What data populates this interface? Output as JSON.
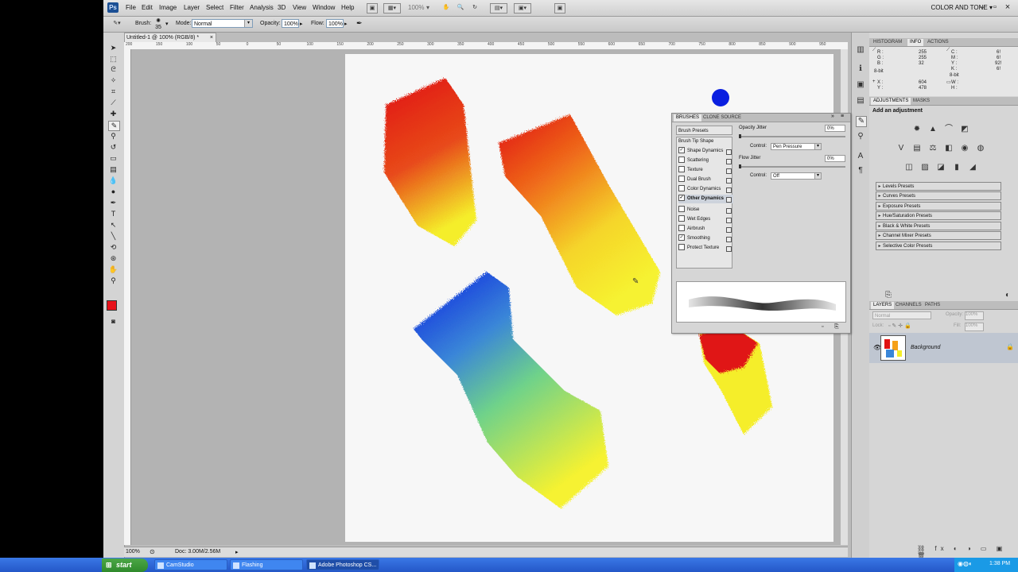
{
  "app": {
    "logo": "Ps",
    "menu": [
      "File",
      "Edit",
      "Image",
      "Layer",
      "Select",
      "Filter",
      "Analysis",
      "3D",
      "View",
      "Window",
      "Help"
    ],
    "zoom_label": "100%",
    "workspace": "COLOR AND TONE"
  },
  "options": {
    "brush_label": "Brush:",
    "brush_size": "35",
    "mode_label": "Mode:",
    "mode_value": "Normal",
    "opacity_label": "Opacity:",
    "opacity_value": "100%",
    "flow_label": "Flow:",
    "flow_value": "100%"
  },
  "document": {
    "tab_title": "Untitled-1 @ 100% (RGB/8) *",
    "zoom": "100%",
    "doc_info": "Doc: 3.00M/2.56M",
    "ruler_labels": [
      "200",
      "150",
      "100",
      "50",
      "0",
      "50",
      "100",
      "150",
      "200",
      "250",
      "300",
      "350",
      "400",
      "450",
      "500",
      "550",
      "600",
      "650",
      "700",
      "750",
      "800",
      "850",
      "900",
      "950"
    ]
  },
  "colors": {
    "foreground": "#e8121b",
    "background": "#ffffff",
    "red": "#e01212",
    "yellow": "#f5ee2a",
    "blue": "#0a1fe0"
  },
  "info_panel": {
    "tabs": [
      "HISTOGRAM",
      "INFO",
      "ACTIONS"
    ],
    "r_label": "R :",
    "r_value": "255",
    "g_label": "G :",
    "g_value": "255",
    "b_label": "B :",
    "b_value": "32",
    "bit1": "8-bit",
    "c_label": "C :",
    "c_value": "",
    "m_label": "M :",
    "m_value": "",
    "y_label": "Y :",
    "y_value": "",
    "k_label": "K :",
    "k_value": "",
    "cmyk_right": [
      "6!",
      "6!",
      "92!",
      "6!"
    ],
    "bit2": "8-bit",
    "x_label": "X :",
    "x_value": "604",
    "y2_label": "Y :",
    "y2_value": "478",
    "w_label": "W :",
    "w_value": "",
    "h_label": "H :",
    "h_value": ""
  },
  "adjustments": {
    "tabs": [
      "ADJUSTMENTS",
      "MASKS"
    ],
    "heading": "Add an adjustment",
    "presets": [
      "Levels Presets",
      "Curves Presets",
      "Exposure Presets",
      "Hue/Saturation Presets",
      "Black & White Presets",
      "Channel Mixer Presets",
      "Selective Color Presets"
    ]
  },
  "layers": {
    "tabs": [
      "LAYERS",
      "CHANNELS",
      "PATHS"
    ],
    "blend_mode": "Normal",
    "opacity_label": "Opacity:",
    "opacity_value": "100%",
    "lock_label": "Lock:",
    "fill_label": "Fill:",
    "fill_value": "100%",
    "layer_name": "Background"
  },
  "brushes": {
    "tabs": [
      "BRUSHES",
      "CLONE SOURCE"
    ],
    "presets_label": "Brush Presets",
    "tip_shape": "Brush Tip Shape",
    "items": [
      {
        "label": "Shape Dynamics",
        "checked": true
      },
      {
        "label": "Scattering",
        "checked": false
      },
      {
        "label": "Texture",
        "checked": false
      },
      {
        "label": "Dual Brush",
        "checked": false
      },
      {
        "label": "Color Dynamics",
        "checked": false
      },
      {
        "label": "Other Dynamics",
        "checked": true
      },
      {
        "label": "Noise",
        "checked": false
      },
      {
        "label": "Wet Edges",
        "checked": false
      },
      {
        "label": "Airbrush",
        "checked": false
      },
      {
        "label": "Smoothing",
        "checked": true
      },
      {
        "label": "Protect Texture",
        "checked": false
      }
    ],
    "opacity_jitter_label": "Opacity Jitter",
    "opacity_jitter_value": "0%",
    "control_label": "Control:",
    "control1_value": "Pen Pressure",
    "flow_jitter_label": "Flow Jitter",
    "flow_jitter_value": "0%",
    "control2_value": "Off"
  },
  "taskbar": {
    "start": "start",
    "items": [
      "CamStudio",
      "Flashing",
      "Adobe Photoshop CS..."
    ],
    "clock": "1:38 PM"
  }
}
